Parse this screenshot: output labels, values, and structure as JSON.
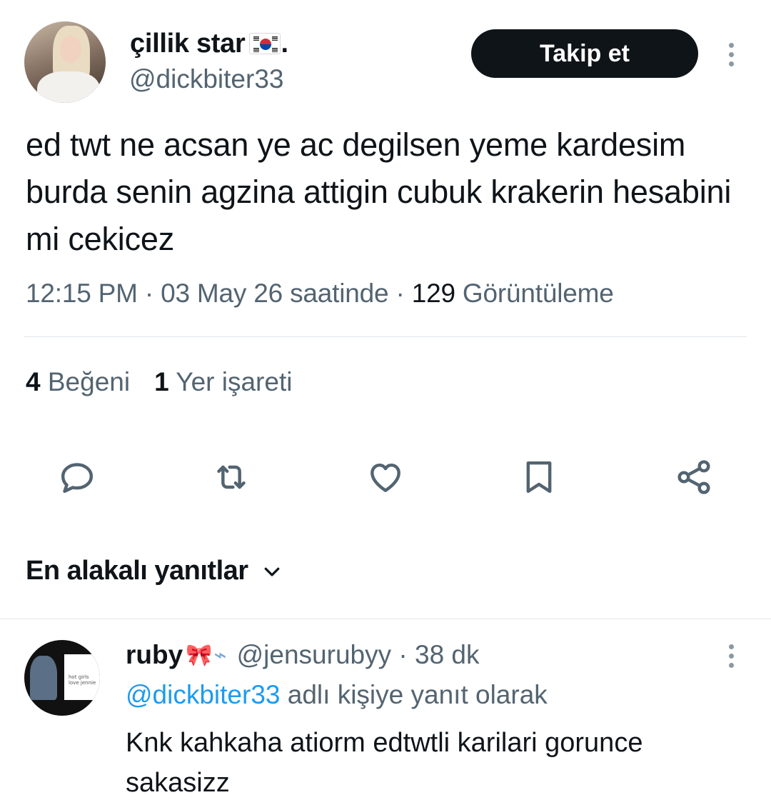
{
  "tweet": {
    "author": {
      "display_name": "çillik star",
      "name_suffix": ".",
      "flag_icon": "south-korea-flag",
      "handle": "@dickbiter33"
    },
    "follow_label": "Takip et",
    "text": "ed twt ne acsan ye ac degilsen yeme kardesim burda senin agzina attigin cubuk krakerin hesabini mi cekicez",
    "meta": {
      "time": "12:15 PM",
      "date": "03 May 26 saatinde",
      "views_count": "129",
      "views_label": "Görüntüleme"
    },
    "stats": {
      "likes_count": "4",
      "likes_label": "Beğeni",
      "bookmarks_count": "1",
      "bookmarks_label": "Yer işareti"
    },
    "actions": [
      "reply-icon",
      "retweet-icon",
      "like-icon",
      "bookmark-icon",
      "share-icon"
    ]
  },
  "replies_sort": {
    "label": "En alakalı yanıtlar"
  },
  "reply": {
    "display_name": "ruby",
    "name_emojis": [
      "bow",
      "wing"
    ],
    "handle": "@jensurubyy",
    "time": "38 dk",
    "reply_to_mention": "@dickbiter33",
    "reply_to_suffix": "adlı kişiye yanıt olarak",
    "text": "Knk kahkaha atiorm edtwtli karilari gorunce sakasizz",
    "avatar_text": "hot girls love jennie"
  },
  "colors": {
    "text_primary": "#0f1419",
    "text_secondary": "#536471",
    "accent": "#1d9bf0",
    "button_bg": "#0f1419"
  }
}
